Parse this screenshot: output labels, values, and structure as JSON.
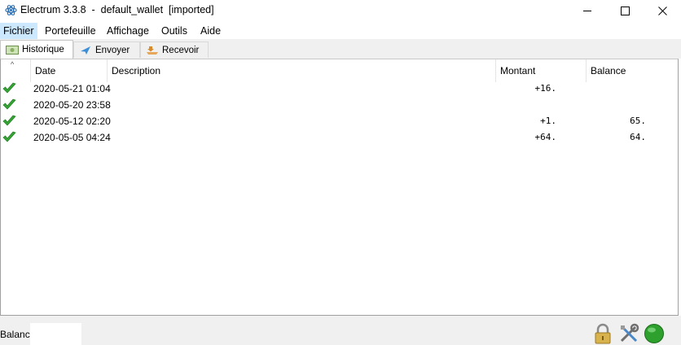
{
  "window": {
    "title": "Electrum 3.3.8  -  default_wallet  [imported]",
    "min_icon": "minimize-icon",
    "max_icon": "maximize-icon",
    "close_icon": "close-icon"
  },
  "menu": {
    "items": [
      {
        "label": "Fichier",
        "active": true
      },
      {
        "label": "Portefeuille"
      },
      {
        "label": "Affichage"
      },
      {
        "label": "Outils"
      },
      {
        "label": "Aide"
      }
    ]
  },
  "tabs": [
    {
      "label": "Historique",
      "icon": "history-icon",
      "active": true
    },
    {
      "label": "Envoyer",
      "icon": "send-icon"
    },
    {
      "label": "Recevoir",
      "icon": "receive-icon"
    }
  ],
  "history": {
    "sort_indicator": "^",
    "columns": [
      "Date",
      "Description",
      "Montant",
      "Balance"
    ],
    "rows": [
      {
        "date": "2020-05-21 01:04",
        "description": "",
        "amount": "+16.",
        "balance": "",
        "status_icon": "confirmed-check-icon"
      },
      {
        "date": "2020-05-20 23:58",
        "description": "",
        "amount": "",
        "balance": "",
        "status_icon": "confirmed-check-icon"
      },
      {
        "date": "2020-05-12 02:20",
        "description": "",
        "amount": "+1.",
        "balance": "65.",
        "status_icon": "confirmed-check-icon"
      },
      {
        "date": "2020-05-05 04:24",
        "description": "",
        "amount": "+64.",
        "balance": "64.",
        "status_icon": "confirmed-check-icon"
      }
    ]
  },
  "status": {
    "balance_label": "Balance:",
    "balance_value": "",
    "icons": [
      "lock-icon",
      "tools-icon",
      "network-status-icon"
    ],
    "network_color": "#2ea02e"
  }
}
